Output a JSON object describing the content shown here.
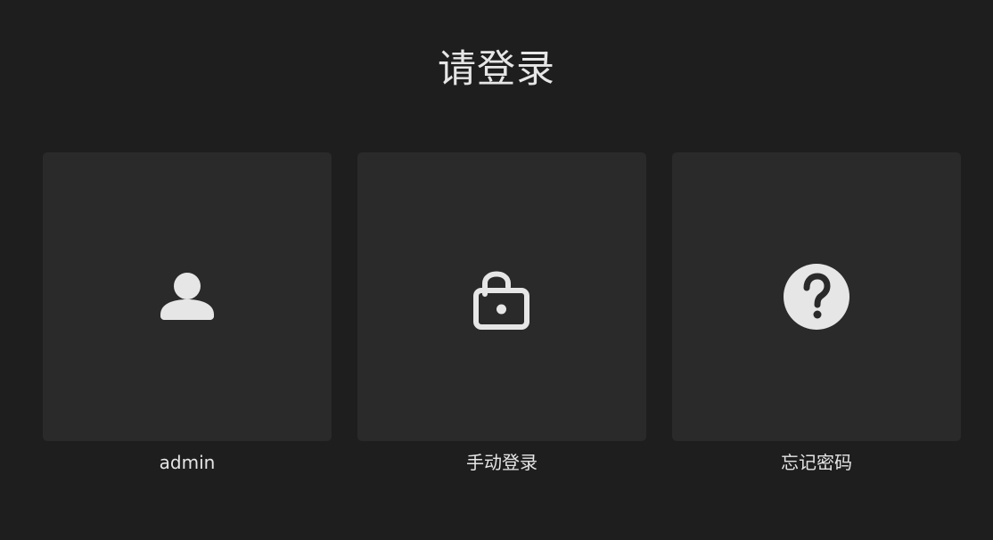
{
  "header": {
    "title": "请登录"
  },
  "options": [
    {
      "id": "admin",
      "label": "admin",
      "icon": "user-icon"
    },
    {
      "id": "manual",
      "label": "手动登录",
      "icon": "unlock-icon"
    },
    {
      "id": "forgot",
      "label": "忘记密码",
      "icon": "help-icon"
    }
  ],
  "colors": {
    "background": "#1e1e1e",
    "tile": "#2a2a2a",
    "text": "#e6e6e6",
    "icon": "#e6e6e6"
  }
}
